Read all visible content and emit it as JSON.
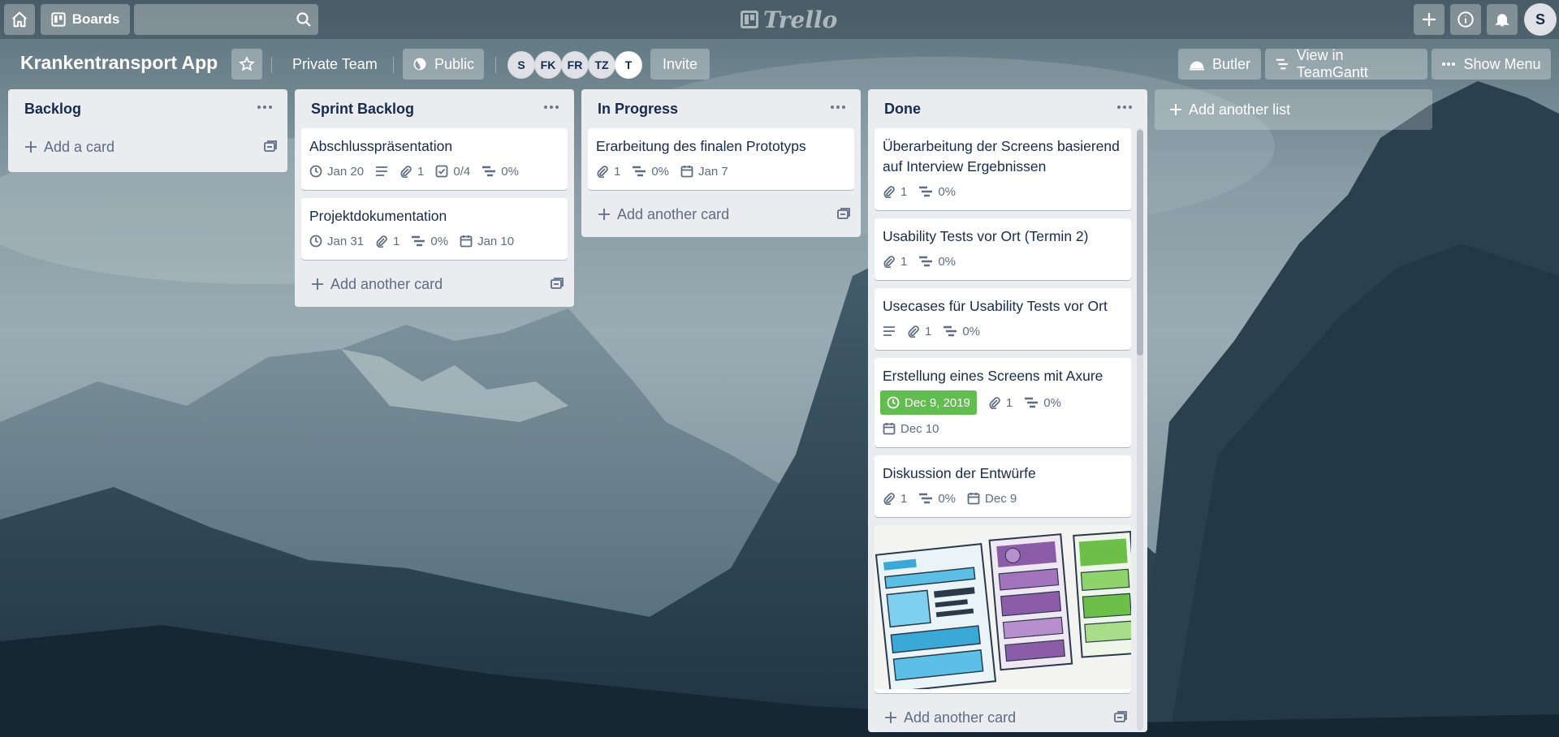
{
  "header": {
    "boards_label": "Boards",
    "search_placeholder": "",
    "logo_text": "Trello",
    "user_initial": "S"
  },
  "board": {
    "title": "Krankentransport App",
    "team": "Private Team",
    "visibility": "Public",
    "members": [
      "S",
      "FK",
      "FR",
      "TZ",
      "T"
    ],
    "invite": "Invite",
    "butler": "Butler",
    "teamgantt": "View in TeamGantt",
    "show_menu": "Show Menu",
    "add_list": "Add another list"
  },
  "lists": [
    {
      "name": "Backlog",
      "add_label": "Add a card",
      "cards": []
    },
    {
      "name": "Sprint Backlog",
      "add_label": "Add another card",
      "cards": [
        {
          "title": "Abschlusspräsentation",
          "due": "Jan 20",
          "description": true,
          "attachments": "1",
          "checklist": "0/4",
          "progress": "0%"
        },
        {
          "title": "Projektdokumentation",
          "due": "Jan 31",
          "attachments": "1",
          "progress": "0%",
          "start": "Jan 10"
        }
      ]
    },
    {
      "name": "In Progress",
      "add_label": "Add another card",
      "cards": [
        {
          "title": "Erarbeitung des finalen Prototyps",
          "attachments": "1",
          "progress": "0%",
          "start": "Jan 7"
        }
      ]
    },
    {
      "name": "Done",
      "add_label": "Add another card",
      "cards": [
        {
          "title": "Überarbeitung der Screens basierend auf Interview Ergebnissen",
          "attachments": "1",
          "progress": "0%"
        },
        {
          "title": "Usability Tests vor Ort (Termin 2)",
          "attachments": "1",
          "progress": "0%"
        },
        {
          "title": "Usecases für Usability Tests vor Ort",
          "description": true,
          "attachments": "1",
          "progress": "0%"
        },
        {
          "title": "Erstellung eines Screens mit Axure",
          "due_complete": "Dec 9, 2019",
          "attachments": "1",
          "progress": "0%",
          "start": "Dec 10"
        },
        {
          "title": "Diskussion der Entwürfe",
          "attachments": "1",
          "progress": "0%",
          "start": "Dec 9"
        }
      ]
    }
  ],
  "colors": {
    "list_bg": "#ebecf0",
    "card_bg": "#ffffff",
    "due_complete": "#61bd4f",
    "text": "#172b4d",
    "muted": "#5e6c84"
  }
}
